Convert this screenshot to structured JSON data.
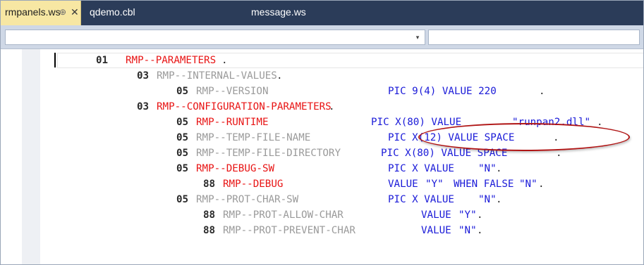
{
  "tabs": [
    {
      "label": "rmpanels.ws",
      "active": true,
      "pin_glyph": "⊕",
      "close_glyph": "✕"
    },
    {
      "label": "qdemo.cbl",
      "active": false
    },
    {
      "label": "message.ws",
      "active": false
    }
  ],
  "navbar": {
    "left_dropdown_value": "",
    "right_dropdown_value": "",
    "dropdown_arrow": "▾"
  },
  "colors": {
    "tab_strip": "#2b3c59",
    "active_tab": "#f7e7a3",
    "keyword_red": "#e81414",
    "keyword_blue": "#1a1ad8",
    "annotation": "#b01414"
  },
  "code": {
    "l1": {
      "level": "01",
      "name": "RMP--PARAMETERS",
      "end": "."
    },
    "l2": {
      "level": "03",
      "name": "RMP--INTERNAL-VALUES",
      "end": "."
    },
    "l3": {
      "level": "05",
      "name": "RMP--VERSION",
      "pic": "PIC 9(4) VALUE 220",
      "end": "."
    },
    "l4": {
      "level": "03",
      "name": "RMP--CONFIGURATION-PARAMETERS",
      "end": "."
    },
    "l5": {
      "level": "05",
      "name": "RMP--RUNTIME",
      "pic": "PIC X(80) VALUE",
      "str": "\"runpan2.dll\"",
      "end": "."
    },
    "l6": {
      "level": "05",
      "name": "RMP--TEMP-FILE-NAME",
      "pic": "PIC X(12) VALUE SPACE",
      "end": "."
    },
    "l7": {
      "level": "05",
      "name": "RMP--TEMP-FILE-DIRECTORY",
      "pic": "PIC X(80) VALUE SPACE",
      "end": "."
    },
    "l8": {
      "level": "05",
      "name": "RMP--DEBUG-SW",
      "pic": "PIC X VALUE",
      "str": "\"N\"",
      "end": "."
    },
    "l9": {
      "level": "88",
      "name": "RMP--DEBUG",
      "pic": "VALUE",
      "str": "\"Y\"",
      "pic2": "WHEN FALSE",
      "str2": "\"N\"",
      "end": "."
    },
    "l10": {
      "level": "05",
      "name": "RMP--PROT-CHAR-SW",
      "pic": "PIC X VALUE",
      "str": "\"N\"",
      "end": "."
    },
    "l11": {
      "level": "88",
      "name": "RMP--PROT-ALLOW-CHAR",
      "pic": "VALUE",
      "str": "\"Y\"",
      "end": "."
    },
    "l12": {
      "level": "88",
      "name": "RMP--PROT-PREVENT-CHAR",
      "pic": "VALUE",
      "str": "\"N\"",
      "end": "."
    }
  }
}
